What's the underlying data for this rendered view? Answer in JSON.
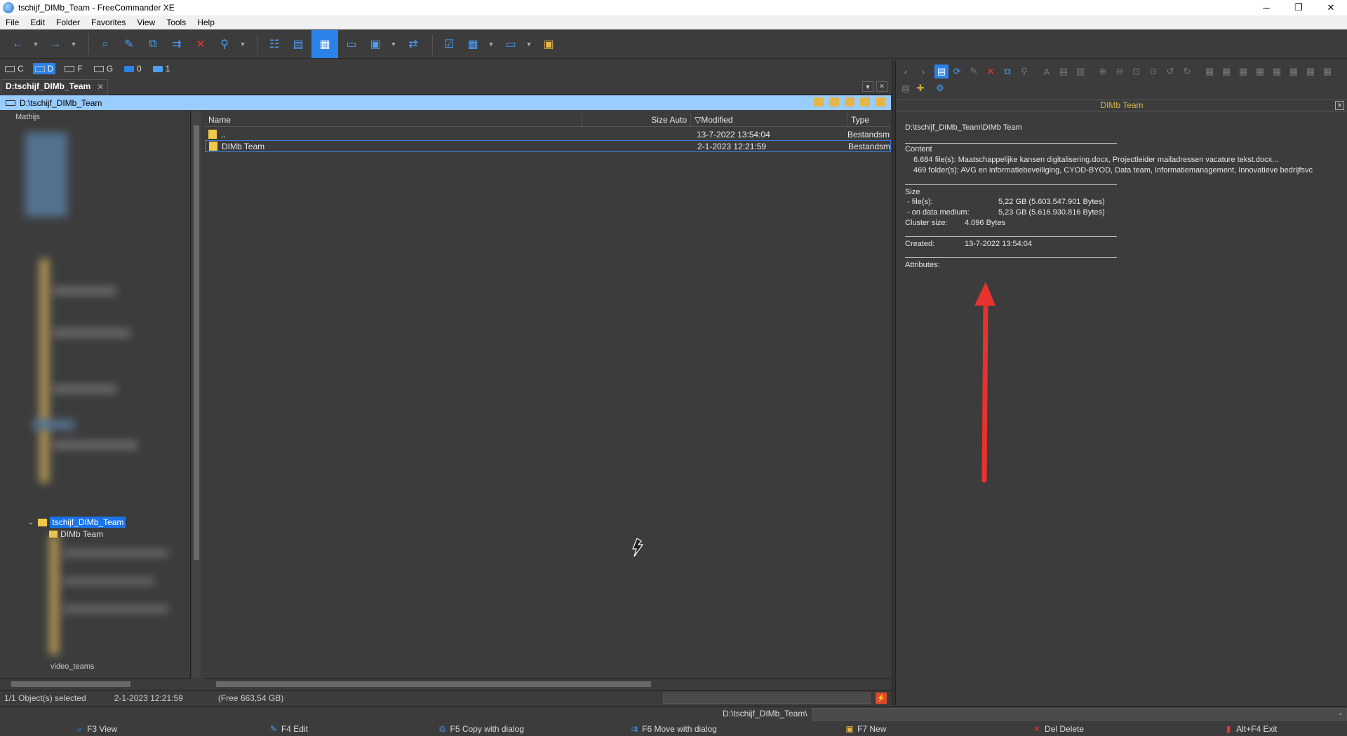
{
  "window": {
    "title": "tschijf_DIMb_Team - FreeCommander XE",
    "minimize": "─",
    "maximize": "❐",
    "close": "✕"
  },
  "menu": [
    "File",
    "Edit",
    "Folder",
    "Favorites",
    "View",
    "Tools",
    "Help"
  ],
  "drives": [
    {
      "letter": "C",
      "selected": false
    },
    {
      "letter": "D",
      "selected": true
    },
    {
      "letter": "F",
      "selected": false
    },
    {
      "letter": "G",
      "selected": false
    },
    {
      "letter": "0",
      "selected": false
    },
    {
      "letter": "1",
      "selected": false
    }
  ],
  "tab": {
    "label": "D:tschijf_DIMb_Team",
    "close": "✕"
  },
  "path": "D:\\tschijf_DIMb_Team",
  "tree": {
    "top_label": "Mathijs",
    "selected": "tschijf_DIMb_Team",
    "child": "DIMb Team",
    "bottom_label": "video_teams"
  },
  "columns": {
    "name": "Name",
    "size": "Size Auto",
    "modified": "▽Modified",
    "type": "Type"
  },
  "rows": [
    {
      "name": "..",
      "modified": "13-7-2022 13:54:04",
      "type": "Bestandsm"
    },
    {
      "name": "DIMb Team",
      "modified": "2-1-2023 12:21:59",
      "type": "Bestandsm"
    }
  ],
  "status": {
    "selected": "1/1 Object(s) selected",
    "date": "2-1-2023 12:21:59",
    "free": "(Free 663,54 GB)"
  },
  "quickview": {
    "title": "DIMb Team",
    "path": "D:\\tschijf_DIMb_Team\\DIMb Team",
    "content_label": "Content",
    "files_line": "6.684 file(s):  Maatschappelijke kansen digitalisering.docx, Projectleider mailadressen vacature tekst.docx...",
    "folders_line": "469 folder(s):  AVG en informatiebeveiliging, CYOD-BYOD, Data team, Informatiemanagement, Innovatieve bedrijfsvc",
    "size_label": "Size",
    "files_size_label": "- file(s):",
    "files_size_value": "5,22 GB (5.603.547.901 Bytes)",
    "medium_label": "- on data medium:",
    "medium_value": "5,23 GB (5.616.930.816 Bytes)",
    "cluster_label": "Cluster size:",
    "cluster_value": "4.096 Bytes",
    "created_label": "Created:",
    "created_value": "13-7-2022 13:54:04",
    "attributes_label": "Attributes:",
    "close": "✕"
  },
  "cmdline": {
    "path": "D:\\tschijf_DIMb_Team\\"
  },
  "fkeys": [
    {
      "label": "F3 View",
      "icon": "magnifier-icon"
    },
    {
      "label": "F4 Edit",
      "icon": "pencil-icon"
    },
    {
      "label": "F5 Copy with dialog",
      "icon": "copy-icon"
    },
    {
      "label": "F6 Move with dialog",
      "icon": "move-icon"
    },
    {
      "label": "F7 New",
      "icon": "new-folder-icon"
    },
    {
      "label": "Del Delete",
      "icon": "delete-icon"
    },
    {
      "label": "Alt+F4 Exit",
      "icon": "exit-icon"
    }
  ],
  "colors": {
    "accent": "#2b82e8",
    "pathbar": "#99ccff",
    "folder": "#f1c94a",
    "arrow": "#e8322e",
    "qv_title": "#d5b64a"
  }
}
